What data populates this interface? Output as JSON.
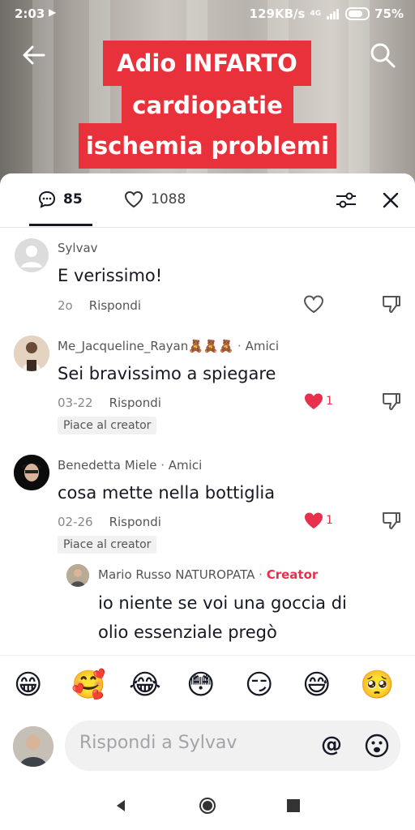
{
  "status_bar": {
    "time": "2:03",
    "network_speed": "129KB/s",
    "network_type": "4G",
    "battery": "75%"
  },
  "video": {
    "caption_lines": [
      "Adio INFARTO",
      "cardiopatie",
      "ischemia problemi"
    ]
  },
  "sheet_header": {
    "comments_count": "85",
    "likes_count": "1088"
  },
  "comments": [
    {
      "name": "Sylvav",
      "tag": "",
      "text": "E verissimo!",
      "date": "2o",
      "reply_label": "Rispondi",
      "likes": "",
      "liked": false,
      "creator_badge": ""
    },
    {
      "name": "Me_Jacqueline_Rayan🧸🧸🧸",
      "tag": "Amici",
      "text": "Sei bravissimo a spiegare",
      "date": "03-22",
      "reply_label": "Rispondi",
      "likes": "1",
      "liked": true,
      "creator_badge": "Piace al creator"
    },
    {
      "name": "Benedetta Miele",
      "tag": "Amici",
      "text": "cosa mette nella bottiglia",
      "date": "02-26",
      "reply_label": "Rispondi",
      "likes": "1",
      "liked": true,
      "creator_badge": "Piace al creator"
    }
  ],
  "reply": {
    "name": "Mario Russo NATUROPATA",
    "tag": "Creator",
    "text_line1": "io niente se voi una goccia di",
    "text_line2": "olio essenziale pregò"
  },
  "emoji_bar": [
    "😁",
    "🥰",
    "😂",
    "😳",
    "😏",
    "😅",
    "🥺"
  ],
  "input": {
    "placeholder": "Rispondi a Sylvav",
    "at_symbol": "@"
  },
  "colors": {
    "accent_red": "#e8313a",
    "like_red": "#e8304c",
    "creator_red": "#e8304c"
  }
}
